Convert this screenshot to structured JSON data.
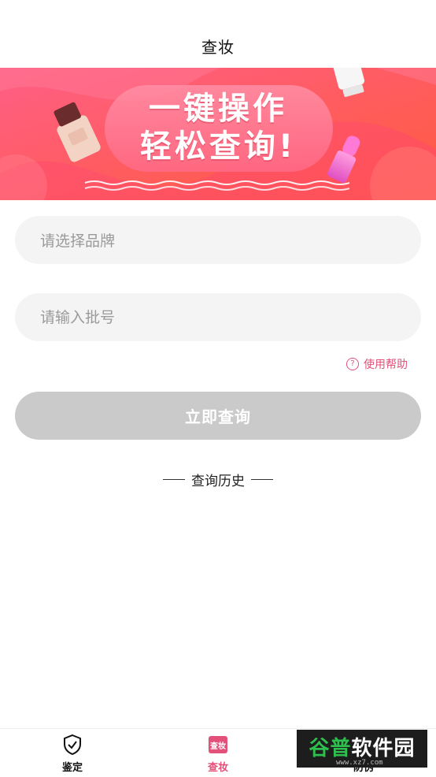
{
  "header": {
    "title": "查妆"
  },
  "banner": {
    "line1": "一键操作",
    "line2": "轻松查询!",
    "colors": {
      "bg_from": "#ff5a7e",
      "bg_to": "#ff6a4a",
      "pill": "#ff7a93"
    }
  },
  "form": {
    "brand_placeholder": "请选择品牌",
    "batch_placeholder": "请输入批号",
    "help_label": "使用帮助",
    "help_icon": "question-circle-icon",
    "query_button_label": "立即查询"
  },
  "history": {
    "label": "查询历史"
  },
  "bottom_nav": {
    "items": [
      {
        "label": "鉴定",
        "icon": "shield-check-icon"
      },
      {
        "label": "查妆",
        "icon": "chazhuang-icon",
        "icon_text": "查妆",
        "active": true
      },
      {
        "label": "防伪",
        "icon": "refresh-icon"
      }
    ]
  },
  "watermark": {
    "text_a": "谷普",
    "text_b": "软件园",
    "url": "www.xz7.com"
  },
  "colors": {
    "accent": "#e3507a",
    "button_disabled": "#cacaca",
    "field_bg": "#f4f4f4"
  }
}
